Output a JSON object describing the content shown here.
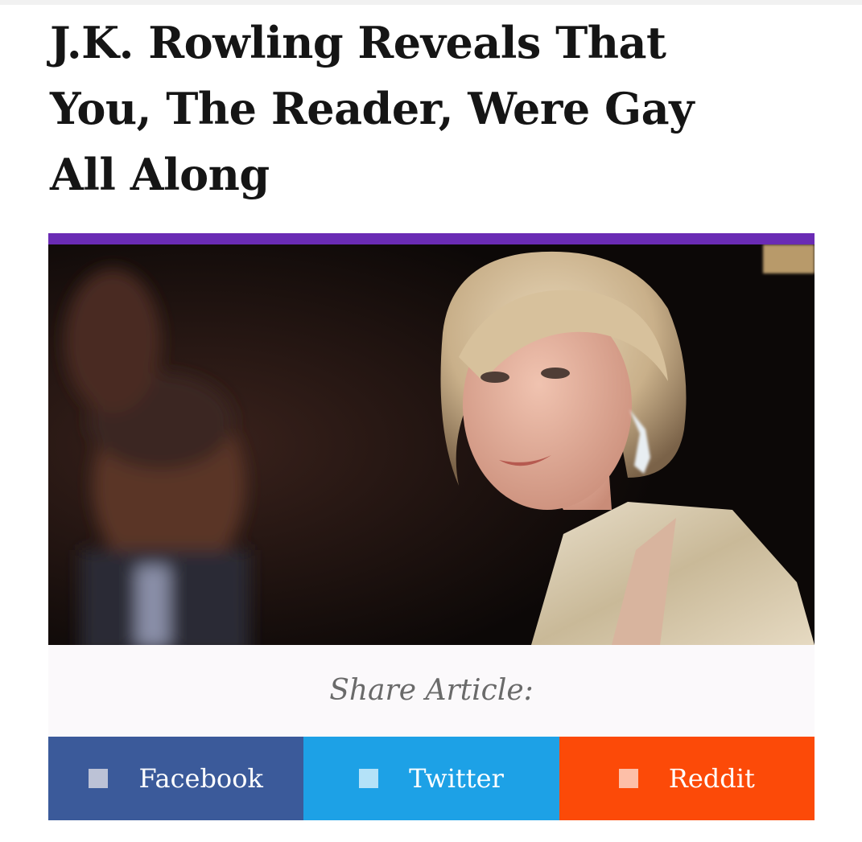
{
  "article": {
    "headline_lines": [
      "J.K. Rowling Reveals That",
      "You, The Reader, Were Gay",
      "All Along"
    ]
  },
  "colors": {
    "accent_bar": "#6a2bb4",
    "facebook": "#3b5a9a",
    "twitter": "#1da1e6",
    "reddit": "#fc4a08"
  },
  "share": {
    "label": "Share Article:",
    "buttons": [
      {
        "label": "Facebook",
        "icon": "facebook-icon"
      },
      {
        "label": "Twitter",
        "icon": "twitter-icon"
      },
      {
        "label": "Reddit",
        "icon": "reddit-icon"
      }
    ]
  }
}
